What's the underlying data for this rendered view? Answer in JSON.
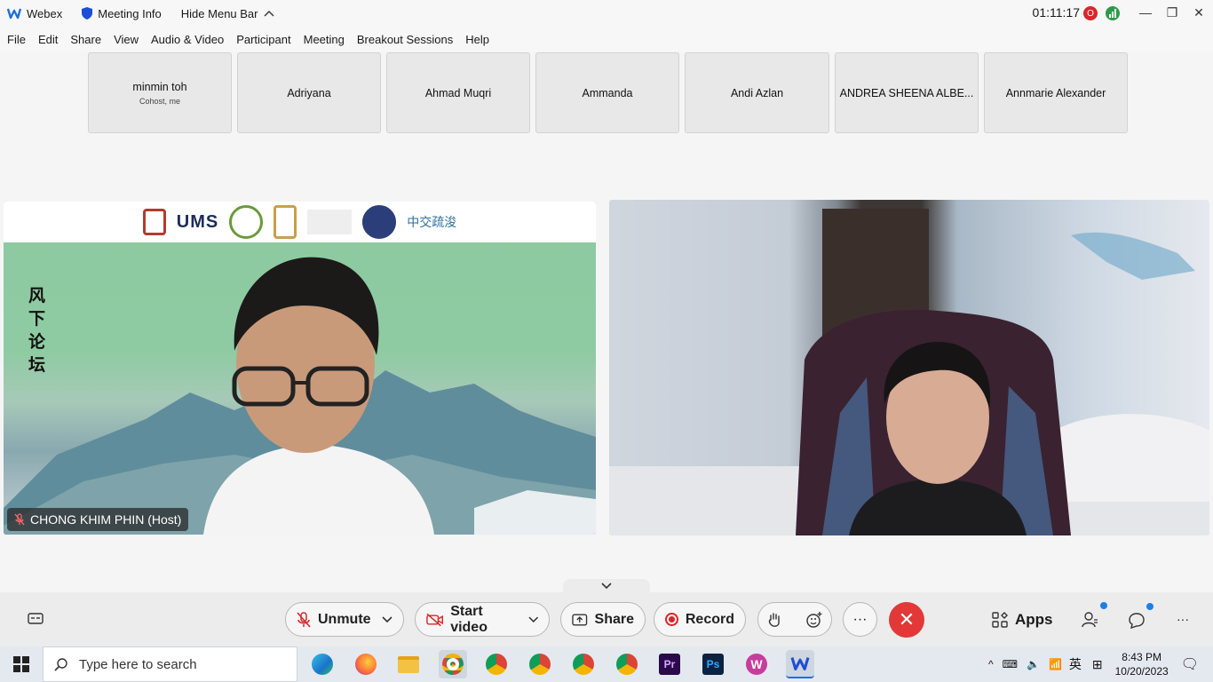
{
  "titlebar": {
    "app_name": "Webex",
    "meeting_info": "Meeting Info",
    "hide_menu": "Hide Menu Bar",
    "timer": "01:11:17",
    "rec_badge": "O"
  },
  "menu": [
    "File",
    "Edit",
    "Share",
    "View",
    "Audio & Video",
    "Participant",
    "Meeting",
    "Breakout Sessions",
    "Help"
  ],
  "participants": [
    {
      "name": "minmin toh",
      "sub": "Cohost, me"
    },
    {
      "name": "Adriyana",
      "sub": ""
    },
    {
      "name": "Ahmad Muqri",
      "sub": ""
    },
    {
      "name": "Ammanda",
      "sub": ""
    },
    {
      "name": "Andi Azlan",
      "sub": ""
    },
    {
      "name": "ANDREA SHEENA ALBE...",
      "sub": ""
    },
    {
      "name": "Annmarie Alexander",
      "sub": ""
    }
  ],
  "video1": {
    "host_label": "CHONG KHIM PHIN (Host)",
    "banner_text": "UMS",
    "vertical_text": "风下论坛",
    "cn_logo": "中交疏浚"
  },
  "toolbar": {
    "unmute": "Unmute",
    "start_video": "Start video",
    "share": "Share",
    "record": "Record",
    "apps": "Apps"
  },
  "taskbar": {
    "search_placeholder": "Type here to search",
    "time": "8:43 PM",
    "date": "10/20/2023",
    "ime": "英"
  },
  "colors": {
    "leave": "#e23838",
    "record": "#d9262a",
    "accent": "#1d7ee8"
  }
}
